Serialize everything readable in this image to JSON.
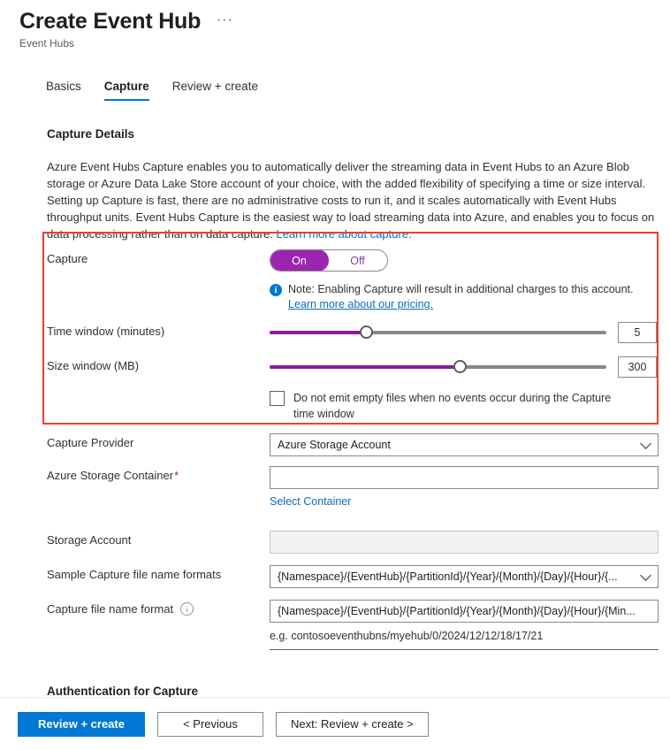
{
  "header": {
    "title": "Create Event Hub",
    "subtitle": "Event Hubs",
    "more_label": "···"
  },
  "tabs": [
    {
      "label": "Basics",
      "active": false
    },
    {
      "label": "Capture",
      "active": true
    },
    {
      "label": "Review + create",
      "active": false
    }
  ],
  "section": {
    "title": "Capture Details",
    "intro": "Azure Event Hubs Capture enables you to automatically deliver the streaming data in Event Hubs to an Azure Blob storage or Azure Data Lake Store account of your choice, with the added flexibility of specifying a time or size interval. Setting up Capture is fast, there are no administrative costs to run it, and it scales automatically with Event Hubs throughput units. Event Hubs Capture is the easiest way to load streaming data into Azure, and enables you to focus on data processing rather than on data capture.",
    "intro_link": "Learn more about capture."
  },
  "capture": {
    "label": "Capture",
    "toggle_on": "On",
    "toggle_off": "Off",
    "selected": "On",
    "note": "Note: Enabling Capture will result in additional charges to this account.",
    "note_link": "Learn more about our pricing.",
    "info_glyph": "i"
  },
  "time_window": {
    "label": "Time window (minutes)",
    "value": "5",
    "percent": 28.5,
    "min": "1",
    "max": "15"
  },
  "size_window": {
    "label": "Size window (MB)",
    "value": "300",
    "percent": 56.5,
    "min": "10",
    "max": "500"
  },
  "empty_files": {
    "checked": false,
    "label": "Do not emit empty files when no events occur during the Capture time window"
  },
  "capture_provider": {
    "label": "Capture Provider",
    "value": "Azure Storage Account"
  },
  "storage_container": {
    "label": "Azure Storage Container",
    "required_mark": "*",
    "value": "",
    "select_link": "Select Container"
  },
  "storage_account": {
    "label": "Storage Account",
    "value": ""
  },
  "sample_format": {
    "label": "Sample Capture file name formats",
    "value": "{Namespace}/{EventHub}/{PartitionId}/{Year}/{Month}/{Day}/{Hour}/{..."
  },
  "file_name_format": {
    "label": "Capture file name format",
    "info_glyph": "i",
    "value": "{Namespace}/{EventHub}/{PartitionId}/{Year}/{Month}/{Day}/{Hour}/{Min...",
    "example": "e.g. contosoeventhubns/myehub/0/2024/12/12/18/17/21"
  },
  "auth_section": {
    "title": "Authentication for Capture"
  },
  "footer": {
    "review_create": "Review + create",
    "previous": "< Previous",
    "next": "Next: Review + create >"
  },
  "colors": {
    "accent_blue": "#0078d4",
    "link_blue": "#0f6cbd",
    "toggle_purple": "#9b25b0",
    "slider_purple": "#8c19a3",
    "highlight_red": "#e8412c",
    "required_red": "#a4262c"
  }
}
